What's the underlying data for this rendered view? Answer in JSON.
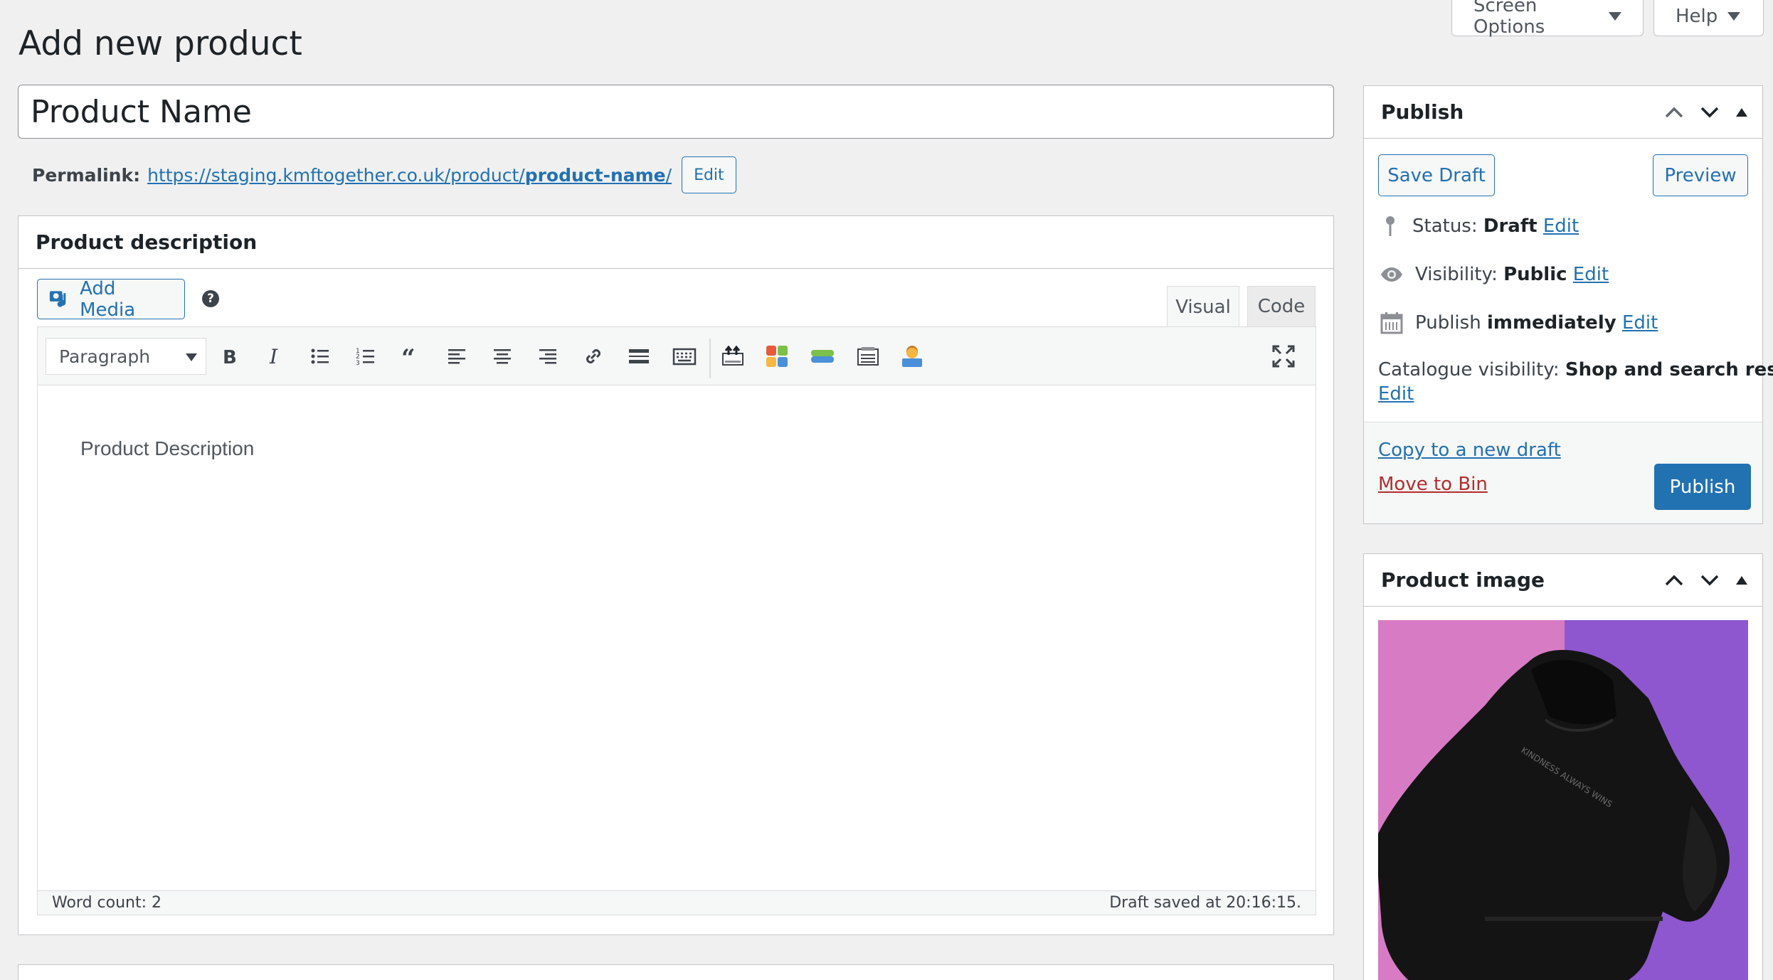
{
  "header": {
    "page_title": "Add new product",
    "screen_options_label": "Screen Options",
    "help_label": "Help"
  },
  "title_field": {
    "value": "Product Name"
  },
  "permalink": {
    "label": "Permalink:",
    "url_base": "https://staging.kmftogether.co.uk/product/",
    "slug": "product-name",
    "url_end": "/",
    "edit_label": "Edit"
  },
  "description": {
    "heading": "Product description",
    "add_media_label": "Add Media",
    "help_icon": "?",
    "tabs": [
      {
        "label": "Visual"
      },
      {
        "label": "Code"
      }
    ],
    "format_select": "Paragraph",
    "content": "Product Description",
    "word_count": "Word count: 2",
    "draft_saved": "Draft saved at 20:16:15."
  },
  "publish": {
    "heading": "Publish",
    "save_draft_label": "Save Draft",
    "preview_label": "Preview",
    "status_label": "Status:",
    "status_value": "Draft",
    "visibility_label": "Visibility:",
    "visibility_value": "Public",
    "publish_prefix": "Publish",
    "publish_value": "immediately",
    "catalogue_label": "Catalogue visibility:",
    "catalogue_value": "Shop and search results",
    "edit_label": "Edit",
    "copy_draft_label": "Copy to a new draft",
    "move_bin_label": "Move to Bin",
    "publish_button_label": "Publish"
  },
  "product_image": {
    "heading": "Product image",
    "shirt_text": "KINDNESS ALWAYS WINS"
  },
  "colors": {
    "accent": "#2271b1",
    "danger": "#b32d2e",
    "background": "#f0f0f1",
    "image_pink": "#d77cc4",
    "image_purple": "#8e57cf"
  }
}
